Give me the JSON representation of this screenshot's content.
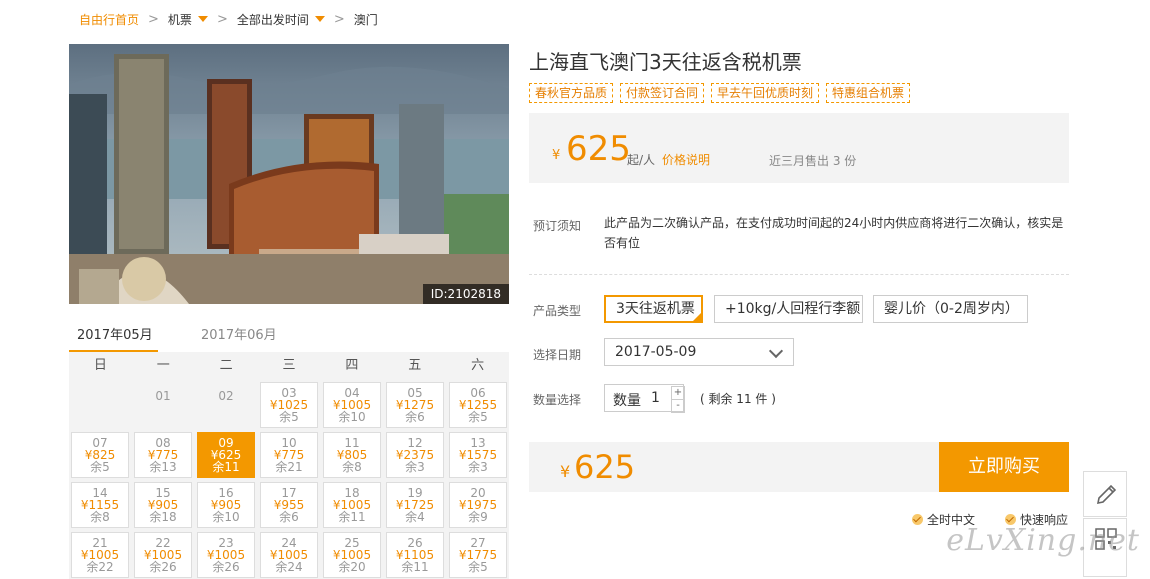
{
  "breadcrumb": {
    "home": "自由行首页",
    "items": [
      "机票",
      "全部出发时间",
      "澳门"
    ]
  },
  "product": {
    "title": "上海直飞澳门3天往返含税机票",
    "image_id": "ID:2102818",
    "tags": [
      "春秋官方品质",
      "付款签订合同",
      "早去午回优质时刻",
      "特惠组合机票"
    ]
  },
  "price": {
    "currency": "¥",
    "value": "625",
    "from_label": "起/人",
    "explain_link": "价格说明",
    "sold": "近三月售出 3 份"
  },
  "notice": {
    "label": "预订须知",
    "text": "此产品为二次确认产品，在支付成功时间起的24小时内供应商将进行二次确认，核实是否有位"
  },
  "product_type": {
    "label": "产品类型",
    "options": [
      "3天往返机票",
      "+10kg/人回程行李额",
      "婴儿价（0-2周岁内）"
    ]
  },
  "date_select": {
    "label": "选择日期",
    "value": "2017-05-09"
  },
  "quantity": {
    "label": "数量选择",
    "field_label": "数量",
    "value": "1",
    "plus": "+",
    "minus": "-",
    "remain": "( 剩余 11 件 )"
  },
  "total": {
    "currency": "¥",
    "value": "625"
  },
  "buy_button": "立即购买",
  "assurances": [
    "全时中文",
    "快速响应"
  ],
  "watermark": "eLvXing.net",
  "calendar": {
    "months": [
      "2017年05月",
      "2017年06月"
    ],
    "weekdays": [
      "日",
      "一",
      "二",
      "三",
      "四",
      "五",
      "六"
    ],
    "weeks": [
      [
        null,
        {
          "day": "01"
        },
        {
          "day": "02"
        },
        {
          "day": "03",
          "price": "¥1025",
          "remain": "余5"
        },
        {
          "day": "04",
          "price": "¥1005",
          "remain": "余10"
        },
        {
          "day": "05",
          "price": "¥1275",
          "remain": "余6"
        },
        {
          "day": "06",
          "price": "¥1255",
          "remain": "余5"
        }
      ],
      [
        {
          "day": "07",
          "price": "¥825",
          "remain": "余5"
        },
        {
          "day": "08",
          "price": "¥775",
          "remain": "余13"
        },
        {
          "day": "09",
          "price": "¥625",
          "remain": "余11",
          "selected": true
        },
        {
          "day": "10",
          "price": "¥775",
          "remain": "余21"
        },
        {
          "day": "11",
          "price": "¥805",
          "remain": "余8"
        },
        {
          "day": "12",
          "price": "¥2375",
          "remain": "余3"
        },
        {
          "day": "13",
          "price": "¥1575",
          "remain": "余3"
        }
      ],
      [
        {
          "day": "14",
          "price": "¥1155",
          "remain": "余8"
        },
        {
          "day": "15",
          "price": "¥905",
          "remain": "余18"
        },
        {
          "day": "16",
          "price": "¥905",
          "remain": "余10"
        },
        {
          "day": "17",
          "price": "¥955",
          "remain": "余6"
        },
        {
          "day": "18",
          "price": "¥1005",
          "remain": "余11"
        },
        {
          "day": "19",
          "price": "¥1725",
          "remain": "余4"
        },
        {
          "day": "20",
          "price": "¥1975",
          "remain": "余9"
        }
      ],
      [
        {
          "day": "21",
          "price": "¥1005",
          "remain": "余22"
        },
        {
          "day": "22",
          "price": "¥1005",
          "remain": "余26"
        },
        {
          "day": "23",
          "price": "¥1005",
          "remain": "余26"
        },
        {
          "day": "24",
          "price": "¥1005",
          "remain": "余24"
        },
        {
          "day": "25",
          "price": "¥1005",
          "remain": "余20"
        },
        {
          "day": "26",
          "price": "¥1105",
          "remain": "余11"
        },
        {
          "day": "27",
          "price": "¥1775",
          "remain": "余5"
        }
      ]
    ]
  },
  "colors": {
    "accent": "#f39800",
    "price": "#f08c00"
  }
}
